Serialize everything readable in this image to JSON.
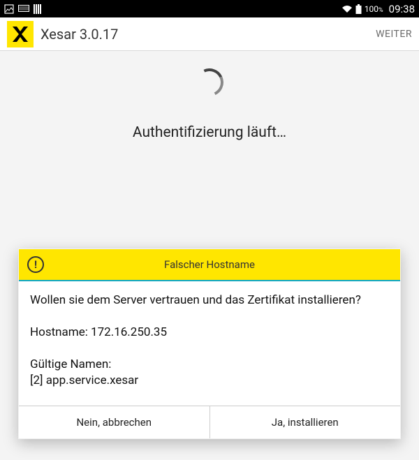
{
  "status": {
    "battery_text": "100",
    "battery_percent_glyph": "%",
    "time": "09:38"
  },
  "appbar": {
    "title": "Xesar 3.0.17",
    "action": "WEITER"
  },
  "content": {
    "auth_text": "Authentifizierung läuft…"
  },
  "dialog": {
    "title": "Falscher Hostname",
    "body": "Wollen sie dem Server vertrauen und das Zertifikat installieren?\n\nHostname: 172.16.250.35\n\nGültige Namen:\n[2] app.service.xesar",
    "cancel": "Nein, abbrechen",
    "confirm": "Ja, installieren"
  }
}
